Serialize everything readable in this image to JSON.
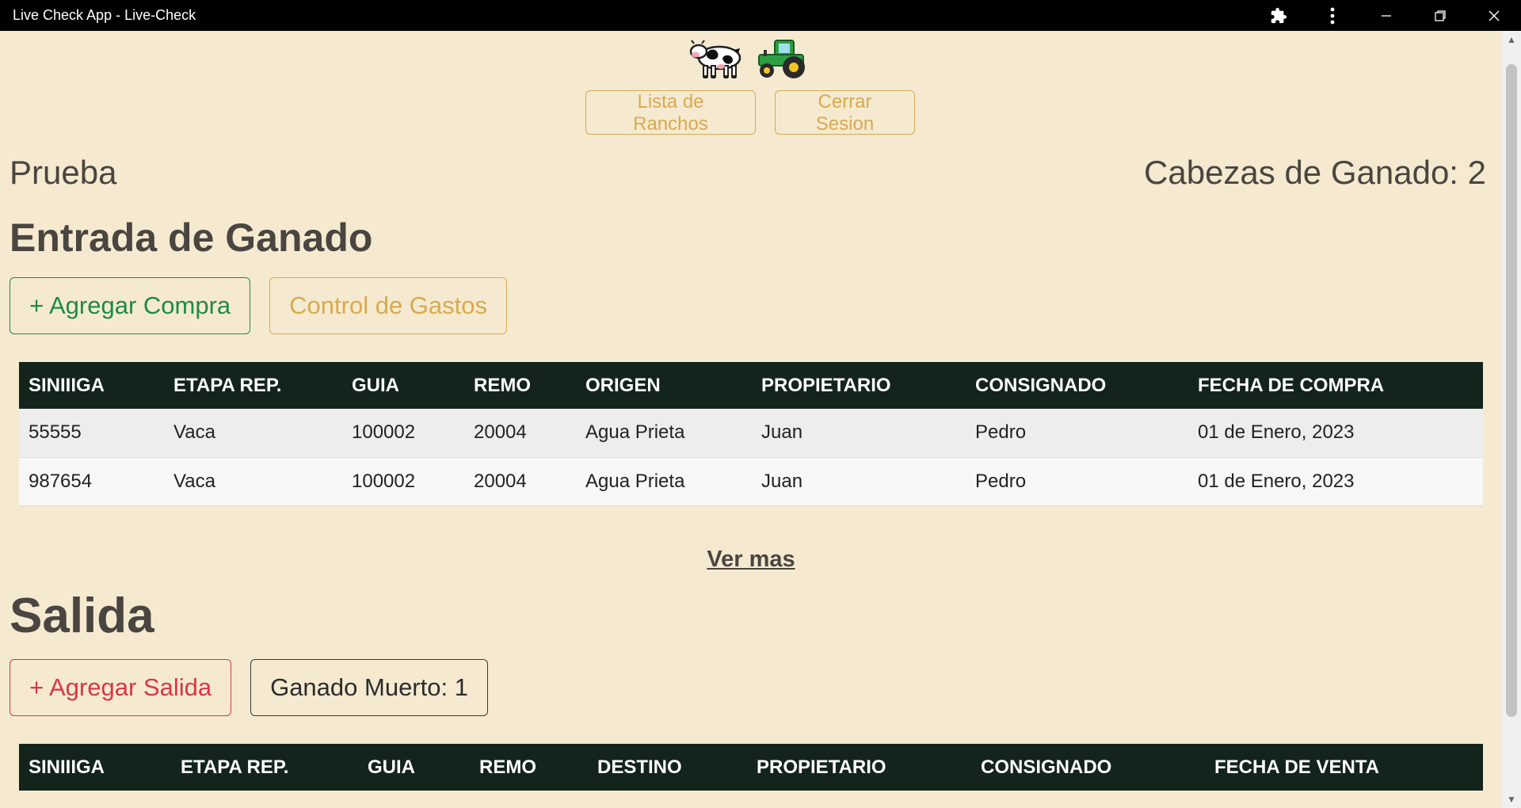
{
  "window": {
    "title": "Live Check App - Live-Check"
  },
  "header": {
    "logo_icons": [
      "cow-icon",
      "tractor-icon"
    ],
    "nav": {
      "ranchos_label": "Lista de Ranchos",
      "logout_label": "Cerrar Sesion"
    }
  },
  "rancho": {
    "name": "Prueba",
    "cabezas_label": "Cabezas de Ganado: 2"
  },
  "entrada": {
    "heading": "Entrada de Ganado",
    "add_label": "+ Agregar Compra",
    "gastos_label": "Control de Gastos",
    "columns": [
      "SINIIIGA",
      "ETAPA REP.",
      "GUIA",
      "REMO",
      "ORIGEN",
      "PROPIETARIO",
      "CONSIGNADO",
      "FECHA DE COMPRA"
    ],
    "rows": [
      [
        "55555",
        "Vaca",
        "100002",
        "20004",
        "Agua Prieta",
        "Juan",
        "Pedro",
        "01 de Enero, 2023"
      ],
      [
        "987654",
        "Vaca",
        "100002",
        "20004",
        "Agua Prieta",
        "Juan",
        "Pedro",
        "01 de Enero, 2023"
      ]
    ],
    "ver_mas": "Ver mas"
  },
  "salida": {
    "heading": "Salida",
    "add_label": "+ Agregar Salida",
    "muerto_label": "Ganado Muerto: 1",
    "columns": [
      "SINIIIGA",
      "ETAPA REP.",
      "GUIA",
      "REMO",
      "DESTINO",
      "PROPIETARIO",
      "CONSIGNADO",
      "FECHA DE VENTA"
    ]
  },
  "colors": {
    "background": "#f5ead0",
    "gold": "#d9a94e",
    "green": "#1e8a47",
    "red": "#dc3545",
    "table_header": "#13241c"
  }
}
